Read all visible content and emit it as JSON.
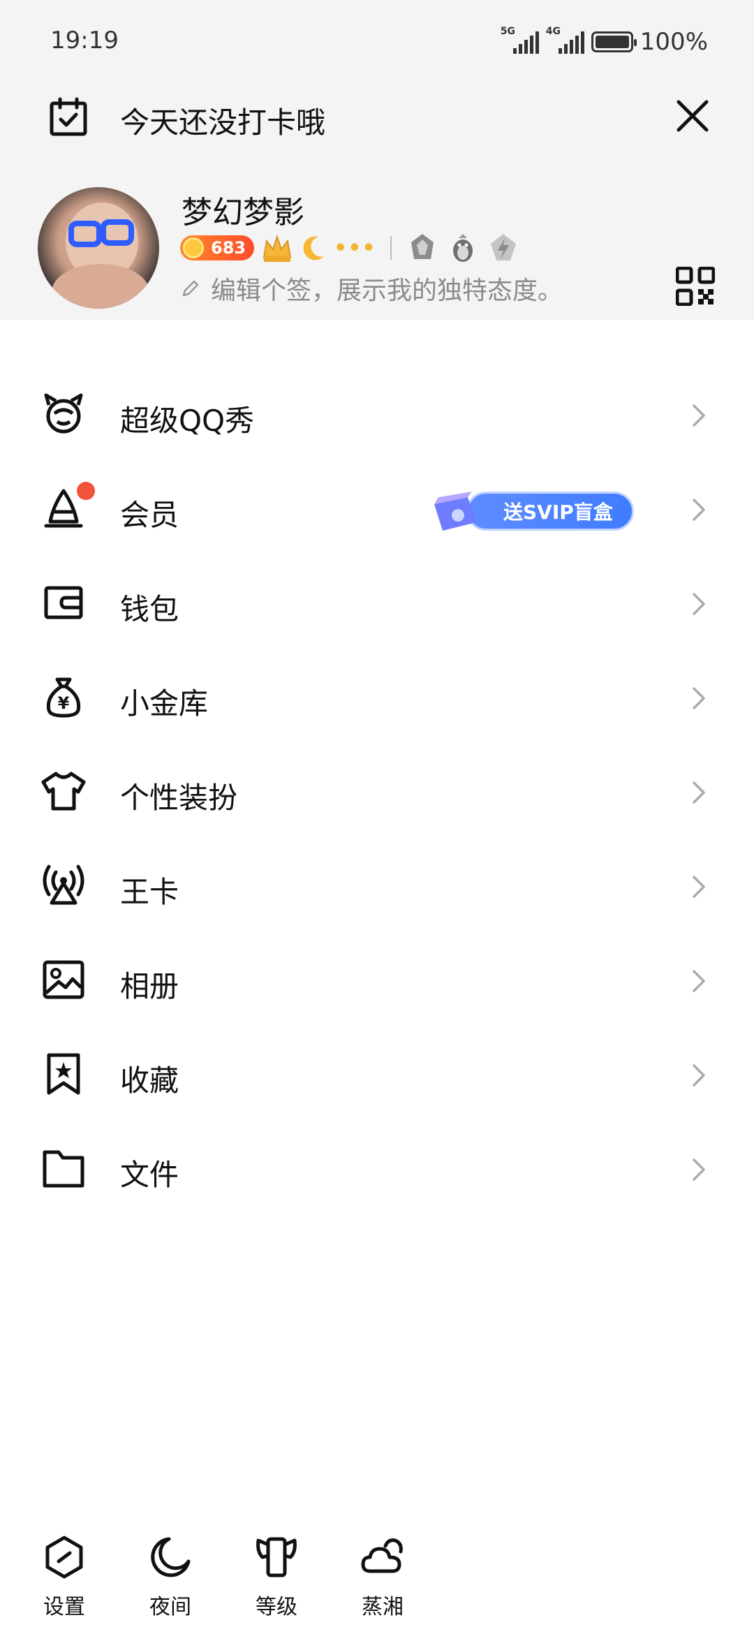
{
  "status_bar": {
    "time": "19:19",
    "network_1": "5G",
    "network_2": "4G",
    "battery": "100%"
  },
  "checkin": {
    "text": "今天还没打卡哦"
  },
  "profile": {
    "username": "梦幻梦影",
    "coin_count": "683",
    "signature_placeholder": "编辑个签，展示我的独特态度。"
  },
  "menu": {
    "items": [
      {
        "label": "超级QQ秀",
        "icon": "qq-show-icon"
      },
      {
        "label": "会员",
        "icon": "vip-icon",
        "promo": "送SVIP盲盒"
      },
      {
        "label": "钱包",
        "icon": "wallet-icon"
      },
      {
        "label": "小金库",
        "icon": "money-bag-icon"
      },
      {
        "label": "个性装扮",
        "icon": "tshirt-icon"
      },
      {
        "label": "王卡",
        "icon": "signal-card-icon"
      },
      {
        "label": "相册",
        "icon": "album-icon"
      },
      {
        "label": "收藏",
        "icon": "bookmark-icon"
      },
      {
        "label": "文件",
        "icon": "folder-icon"
      }
    ]
  },
  "bottom": {
    "items": [
      {
        "label": "设置",
        "icon": "settings-icon"
      },
      {
        "label": "夜间",
        "icon": "moon-icon"
      },
      {
        "label": "等级",
        "icon": "level-icon"
      },
      {
        "label": "蒸湘",
        "icon": "weather-icon"
      }
    ]
  },
  "colors": {
    "header_bg": "#f4f4f4",
    "notification_dot": "#f2513b",
    "promo_blue": "#3f7cff",
    "coin_orange": "#ff6a2b"
  }
}
